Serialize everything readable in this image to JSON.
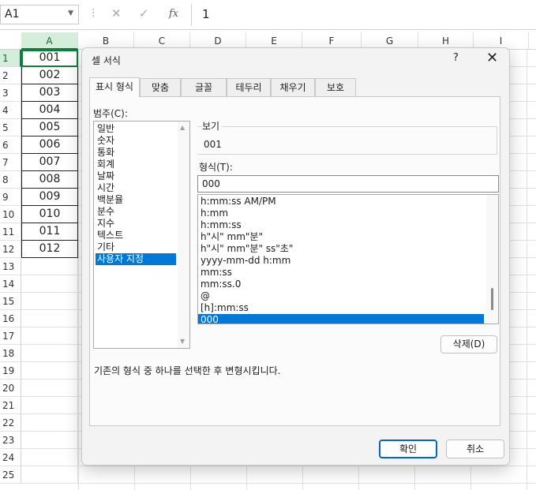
{
  "formula_bar": {
    "name_box": "A1",
    "input": "1",
    "dots": "⋮",
    "cancel_glyph": "✕",
    "enter_glyph": "✓",
    "fx_label": "fx"
  },
  "grid": {
    "columns": [
      "A",
      "B",
      "C",
      "D",
      "E",
      "F",
      "G",
      "H",
      "I"
    ],
    "rows": [
      "1",
      "2",
      "3",
      "4",
      "5",
      "6",
      "7",
      "8",
      "9",
      "10",
      "11",
      "12",
      "13",
      "14",
      "15",
      "16",
      "17",
      "18",
      "19",
      "20",
      "21",
      "22",
      "23",
      "24",
      "25"
    ],
    "column_a_values": [
      "001",
      "002",
      "003",
      "004",
      "005",
      "006",
      "007",
      "008",
      "009",
      "010",
      "011",
      "012"
    ]
  },
  "dialog": {
    "title": "셀 서식",
    "help": "?",
    "close": "✕",
    "tabs": [
      "표시 형식",
      "맞춤",
      "글꼴",
      "테두리",
      "채우기",
      "보호"
    ],
    "category_label": "범주(C):",
    "categories": [
      "일반",
      "숫자",
      "통화",
      "회계",
      "날짜",
      "시간",
      "백분율",
      "분수",
      "지수",
      "텍스트",
      "기타",
      "사용자 지정"
    ],
    "selected_category": "사용자 지정",
    "sample_label": "보기",
    "sample_value": "001",
    "type_label": "형식(T):",
    "type_value": "000",
    "formats": [
      "h:mm:ss AM/PM",
      "h:mm",
      "h:mm:ss",
      "h\"시\" mm\"분\"",
      "h\"시\" mm\"분\" ss\"초\"",
      "yyyy-mm-dd h:mm",
      "mm:ss",
      "mm:ss.0",
      "@",
      "[h]:mm:ss",
      "000"
    ],
    "selected_format": "000",
    "delete_button": "삭제(D)",
    "hint": "기존의 형식 중 하나를 선택한 후 변형시킵니다.",
    "ok_button": "확인",
    "cancel_button": "취소"
  },
  "colors": {
    "selection": "#0078d7",
    "excel_green": "#107c41",
    "primary_border": "#0067c0"
  }
}
